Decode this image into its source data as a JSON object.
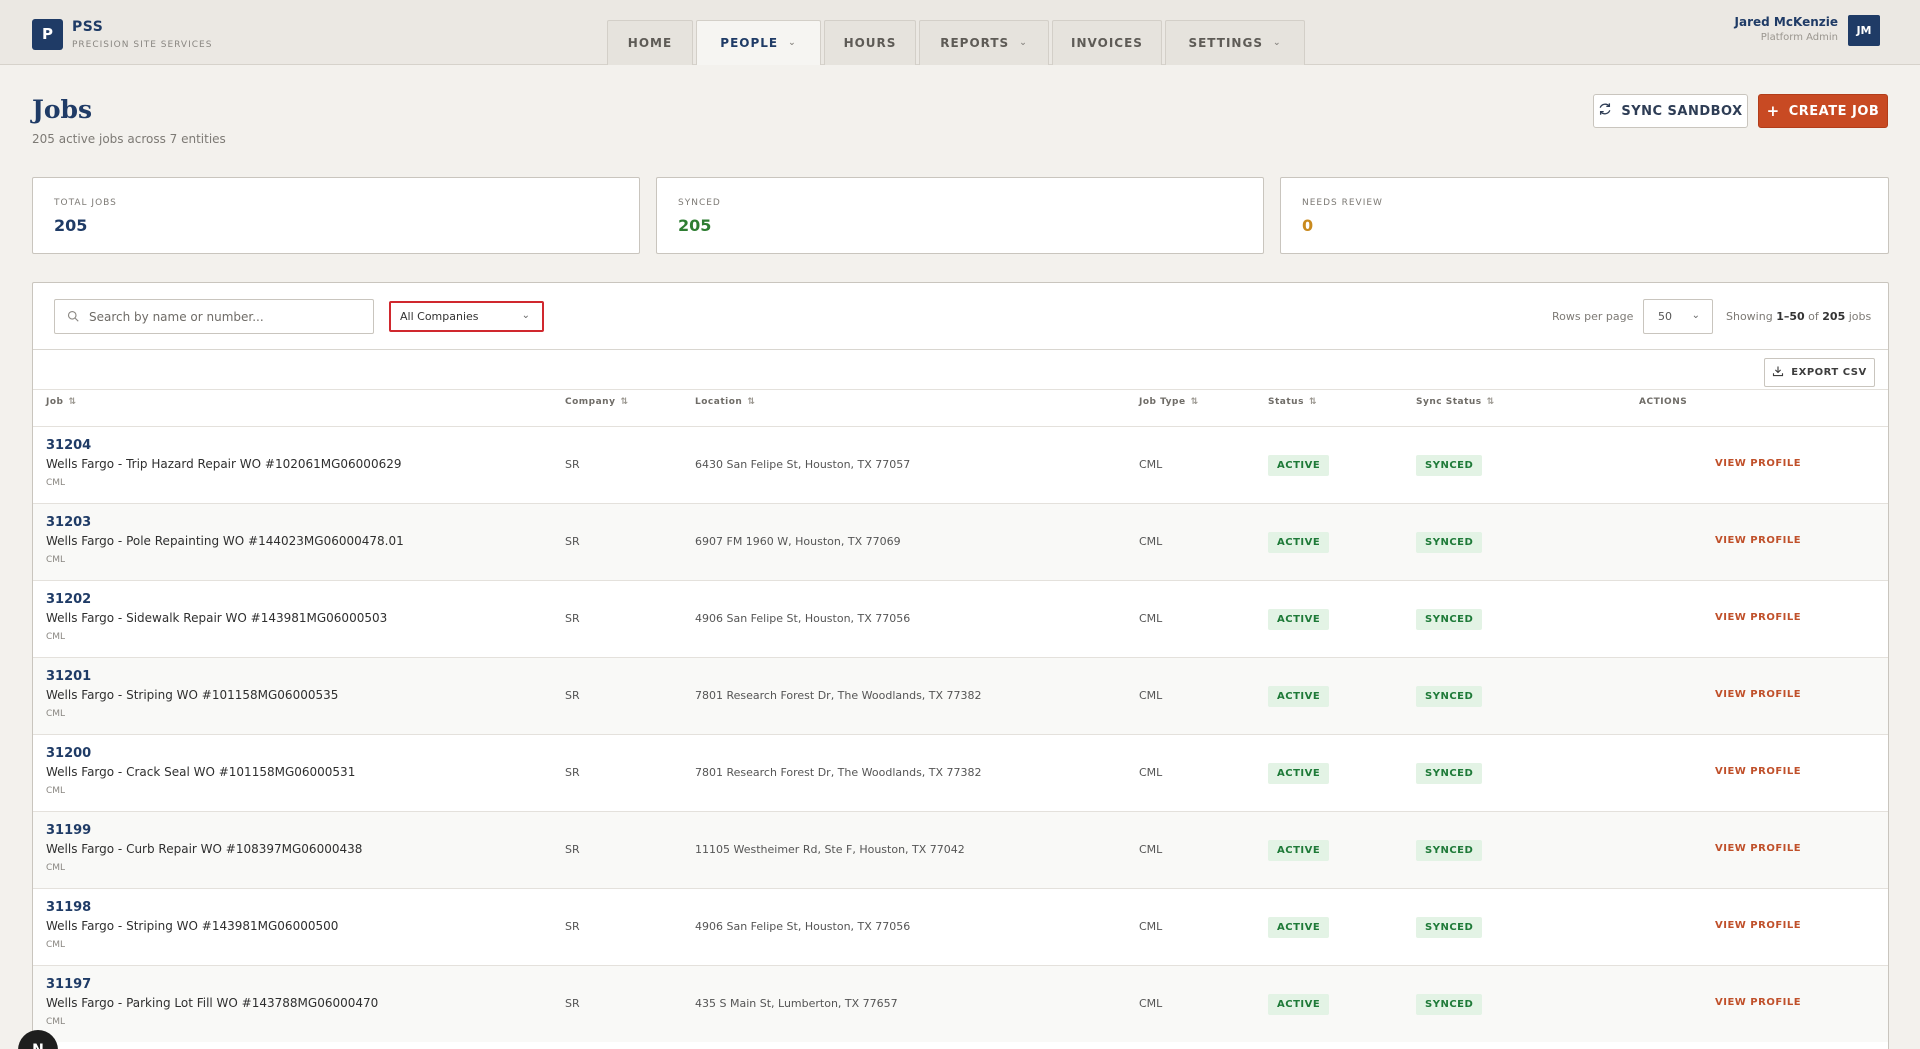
{
  "brand": {
    "logo_letter": "P",
    "name": "PSS",
    "subtitle": "PRECISION SITE SERVICES"
  },
  "nav": [
    {
      "label": "HOME",
      "active": false,
      "dropdown": false
    },
    {
      "label": "PEOPLE",
      "active": true,
      "dropdown": true
    },
    {
      "label": "HOURS",
      "active": false,
      "dropdown": false
    },
    {
      "label": "REPORTS",
      "active": false,
      "dropdown": true
    },
    {
      "label": "INVOICES",
      "active": false,
      "dropdown": false
    },
    {
      "label": "SETTINGS",
      "active": false,
      "dropdown": true
    }
  ],
  "user": {
    "name": "Jared McKenzie",
    "role": "Platform Admin",
    "initials": "JM"
  },
  "header": {
    "title": "Jobs",
    "subtitle": "205 active jobs across 7 entities",
    "sync_label": "SYNC SANDBOX",
    "create_label": "CREATE JOB"
  },
  "stats": [
    {
      "label": "TOTAL JOBS",
      "value": "205",
      "color": "#1f3b66"
    },
    {
      "label": "SYNCED",
      "value": "205",
      "color": "#2e7d32"
    },
    {
      "label": "NEEDS REVIEW",
      "value": "0",
      "color": "#c98a1e"
    }
  ],
  "filters": {
    "search_placeholder": "Search by name or number...",
    "company": "All Companies",
    "rows_label": "Rows per page",
    "rows_value": "50",
    "showing_prefix": "Showing ",
    "showing_range": "1–50",
    "showing_of": " of ",
    "showing_total": "205",
    "showing_suffix": " jobs",
    "export_label": "EXPORT CSV"
  },
  "columns": {
    "job": "Job",
    "company": "Company",
    "location": "Location",
    "job_type": "Job Type",
    "status": "Status",
    "sync_status": "Sync Status",
    "actions": "ACTIONS"
  },
  "rows": [
    {
      "number": "31204",
      "name": "Wells Fargo - Trip Hazard Repair WO #102061MG06000629",
      "type_small": "CML",
      "company": "SR",
      "location": "6430 San Felipe St, Houston, TX 77057",
      "job_type": "CML",
      "status": "ACTIVE",
      "sync": "SYNCED",
      "action": "VIEW PROFILE"
    },
    {
      "number": "31203",
      "name": "Wells Fargo - Pole Repainting WO #144023MG06000478.01",
      "type_small": "CML",
      "company": "SR",
      "location": "6907 FM 1960 W, Houston, TX 77069",
      "job_type": "CML",
      "status": "ACTIVE",
      "sync": "SYNCED",
      "action": "VIEW PROFILE"
    },
    {
      "number": "31202",
      "name": "Wells Fargo - Sidewalk Repair WO #143981MG06000503",
      "type_small": "CML",
      "company": "SR",
      "location": "4906 San Felipe St, Houston, TX 77056",
      "job_type": "CML",
      "status": "ACTIVE",
      "sync": "SYNCED",
      "action": "VIEW PROFILE"
    },
    {
      "number": "31201",
      "name": "Wells Fargo - Striping WO #101158MG06000535",
      "type_small": "CML",
      "company": "SR",
      "location": "7801 Research Forest Dr, The Woodlands, TX 77382",
      "job_type": "CML",
      "status": "ACTIVE",
      "sync": "SYNCED",
      "action": "VIEW PROFILE"
    },
    {
      "number": "31200",
      "name": "Wells Fargo - Crack Seal WO #101158MG06000531",
      "type_small": "CML",
      "company": "SR",
      "location": "7801 Research Forest Dr, The Woodlands, TX 77382",
      "job_type": "CML",
      "status": "ACTIVE",
      "sync": "SYNCED",
      "action": "VIEW PROFILE"
    },
    {
      "number": "31199",
      "name": "Wells Fargo - Curb Repair WO #108397MG06000438",
      "type_small": "CML",
      "company": "SR",
      "location": "11105 Westheimer Rd, Ste F, Houston, TX 77042",
      "job_type": "CML",
      "status": "ACTIVE",
      "sync": "SYNCED",
      "action": "VIEW PROFILE"
    },
    {
      "number": "31198",
      "name": "Wells Fargo - Striping WO #143981MG06000500",
      "type_small": "CML",
      "company": "SR",
      "location": "4906 San Felipe St, Houston, TX 77056",
      "job_type": "CML",
      "status": "ACTIVE",
      "sync": "SYNCED",
      "action": "VIEW PROFILE"
    },
    {
      "number": "31197",
      "name": "Wells Fargo - Parking Lot Fill WO #143788MG06000470",
      "type_small": "CML",
      "company": "SR",
      "location": "435 S Main St, Lumberton, TX 77657",
      "job_type": "CML",
      "status": "ACTIVE",
      "sync": "SYNCED",
      "action": "VIEW PROFILE"
    }
  ],
  "dev_badge": "N"
}
